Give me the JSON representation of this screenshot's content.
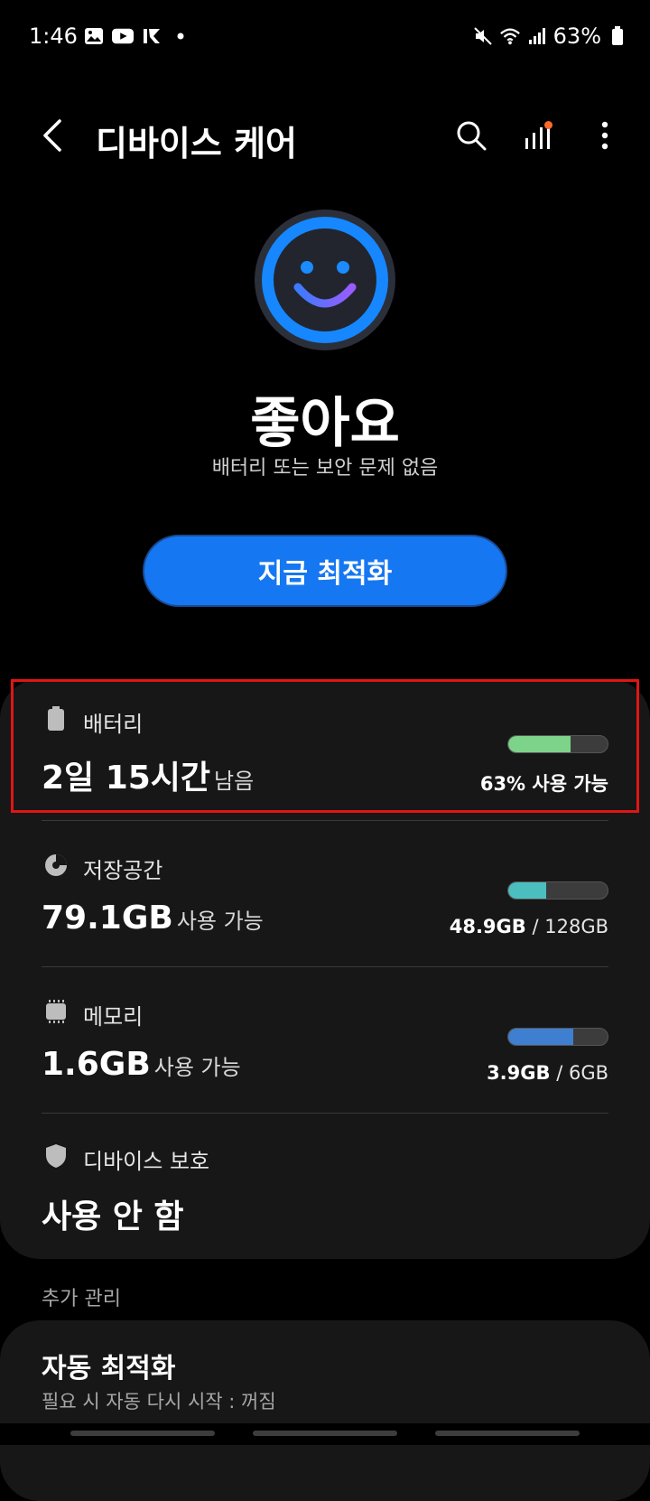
{
  "status_bar": {
    "time": "1:46",
    "battery_percent": "63%"
  },
  "app_bar": {
    "title": "디바이스 케어"
  },
  "hero": {
    "status_title": "좋아요",
    "status_subtitle": "배터리 또는 보안 문제 없음",
    "optimize_label": "지금 최적화"
  },
  "battery": {
    "label": "배터리",
    "value": "2일 15시간",
    "unit": "남음",
    "detail": "63% 사용 가능",
    "level": 0.63,
    "color": "#7ed38a"
  },
  "storage": {
    "label": "저장공간",
    "value": "79.1GB",
    "unit": "사용 가능",
    "used": "48.9GB",
    "total": "/ 128GB",
    "level": 0.38,
    "color": "#4bbfbf"
  },
  "memory": {
    "label": "메모리",
    "value": "1.6GB",
    "unit": "사용 가능",
    "used": "3.9GB",
    "total": "/ 6GB",
    "level": 0.65,
    "color": "#3f7fd1"
  },
  "protection": {
    "label": "디바이스 보호",
    "value": "사용 안 함"
  },
  "additional": {
    "section_label": "추가 관리",
    "auto_title": "자동 최적화",
    "auto_subtitle": "필요 시 자동 다시 시작 : 꺼짐"
  },
  "icons": {
    "back": "chevron-left-icon",
    "search": "search-icon",
    "stats": "bar-chart-icon",
    "more": "more-vertical-icon"
  }
}
